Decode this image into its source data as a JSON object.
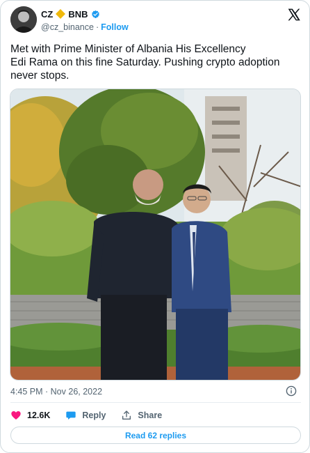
{
  "author": {
    "display_name": "CZ",
    "badge_label": "BNB",
    "handle": "@cz_binance",
    "separator": "·",
    "follow_label": "Follow",
    "avatar_icon": "portrait-avatar",
    "bnb_icon": "bnb-diamond-icon",
    "verified_icon": "verified-badge-icon"
  },
  "tweet": {
    "text": "Met with Prime Minister of Albania His Excellency\nEdi Rama on this fine Saturday. Pushing crypto adoption\nnever stops.",
    "image_icon": "photo-two-men-in-garden"
  },
  "meta": {
    "timestamp": "4:45 PM · Nov 26, 2022"
  },
  "actions": {
    "like_count": "12.6K",
    "reply_label": "Reply",
    "share_label": "Share"
  },
  "footer": {
    "read_replies_label": "Read 62 replies"
  },
  "colors": {
    "accent": "#1d9bf0",
    "like": "#f91880",
    "bnb": "#f0b90b",
    "text_secondary": "#536471"
  }
}
